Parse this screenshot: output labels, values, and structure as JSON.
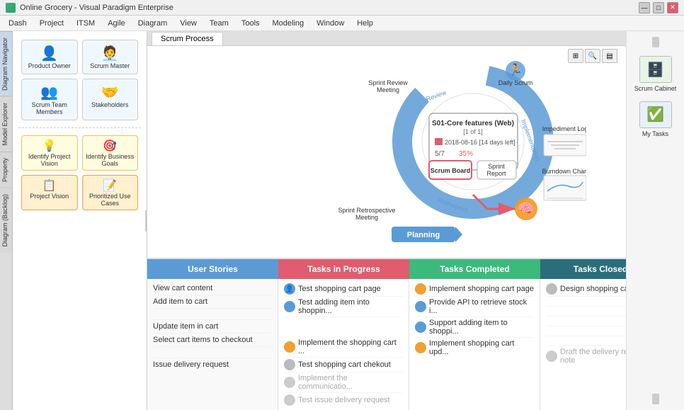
{
  "titlebar": {
    "title": "Online Grocery - Visual Paradigm Enterprise",
    "controls": [
      "minimize",
      "maximize",
      "close"
    ]
  },
  "menubar": {
    "items": [
      "Dash",
      "Project",
      "ITSM",
      "Agile",
      "Diagram",
      "View",
      "Team",
      "Tools",
      "Modeling",
      "Window",
      "Help"
    ]
  },
  "tab": {
    "label": "Scrum Process"
  },
  "left_tabs": [
    "Diagram Navigator",
    "Model Explorer",
    "Property",
    "Diagram (Backlog)"
  ],
  "right_panel": {
    "items": [
      {
        "label": "Scrum Cabinet",
        "icon": "cabinet"
      },
      {
        "label": "My Tasks",
        "icon": "tasks"
      }
    ]
  },
  "diagram": {
    "sprint": {
      "name": "S01-Core features (Web)",
      "count": "[1 of 1]",
      "date": "2018-08-16 [14 days left]",
      "progress": "5/7",
      "percent": "35%",
      "board_label": "Scrum Board",
      "report_label": "Sprint Report"
    },
    "cycle_labels": [
      "Review",
      "Implementation",
      "Retrospect",
      "Planning"
    ],
    "meetings": [
      "Sprint Review Meeting",
      "Daily Scrum",
      "Sprint Retrospective Meeting"
    ],
    "log_labels": [
      "Impediment Log",
      "Burndown Chart"
    ],
    "role_cards": [
      {
        "label": "Product Owner"
      },
      {
        "label": "Scrum Master"
      },
      {
        "label": "Scrum Team Members"
      },
      {
        "label": "Stakeholders"
      }
    ],
    "backlog_items": [
      {
        "label": "Identify Project Vision"
      },
      {
        "label": "Identify Business Goals"
      },
      {
        "label": "Project Vision"
      },
      {
        "label": "Prioritized Use Cases"
      }
    ],
    "planning_label": "Planning"
  },
  "scrum_board": {
    "columns": [
      {
        "label": "User Stories",
        "color": "#5b9bd5"
      },
      {
        "label": "Tasks in Progress",
        "color": "#e05c6e"
      },
      {
        "label": "Tasks Completed",
        "color": "#3bba7c"
      },
      {
        "label": "Tasks Closed",
        "color": "#2a6e7c"
      }
    ],
    "user_stories": [
      "View cart content",
      "Add item to cart",
      "",
      "Update item in cart",
      "Select cart items to checkout",
      "",
      "Issue delivery request"
    ],
    "tasks_in_progress": [
      {
        "text": "Test shopping cart page",
        "avatar": "blue",
        "dimmed": false
      },
      {
        "text": "Test adding item into shoppin...",
        "avatar": "blue",
        "dimmed": false
      },
      {
        "text": "",
        "avatar": "",
        "dimmed": false
      },
      {
        "text": "",
        "avatar": "",
        "dimmed": false
      },
      {
        "text": "Implement the shopping cart ...",
        "avatar": "orange",
        "dimmed": false
      },
      {
        "text": "Test shopping cart chekout",
        "avatar": "gray",
        "dimmed": false
      },
      {
        "text": "Implement the communicatio...",
        "avatar": "gray",
        "dimmed": true
      },
      {
        "text": "Test issue delivery request",
        "avatar": "gray",
        "dimmed": true
      }
    ],
    "tasks_completed": [
      {
        "text": "Implement shopping cart page",
        "avatar": "orange",
        "dimmed": false
      },
      {
        "text": "Provide API to retrieve stock i...",
        "avatar": "blue",
        "dimmed": false
      },
      {
        "text": "Support adding item to shoppi...",
        "avatar": "blue",
        "dimmed": false
      },
      {
        "text": "Implement shopping cart upd...",
        "avatar": "orange",
        "dimmed": false
      },
      {
        "text": "",
        "avatar": "",
        "dimmed": false
      },
      {
        "text": "",
        "avatar": "",
        "dimmed": false
      },
      {
        "text": "",
        "avatar": "",
        "dimmed": false
      },
      {
        "text": "",
        "avatar": "",
        "dimmed": false
      }
    ],
    "tasks_closed": [
      {
        "text": "Design shopping cart page",
        "avatar": "gray",
        "dimmed": false
      },
      {
        "text": "",
        "avatar": "",
        "dimmed": false
      },
      {
        "text": "",
        "avatar": "",
        "dimmed": false
      },
      {
        "text": "Draft the delivery request note",
        "avatar": "gray",
        "dimmed": true
      }
    ]
  }
}
